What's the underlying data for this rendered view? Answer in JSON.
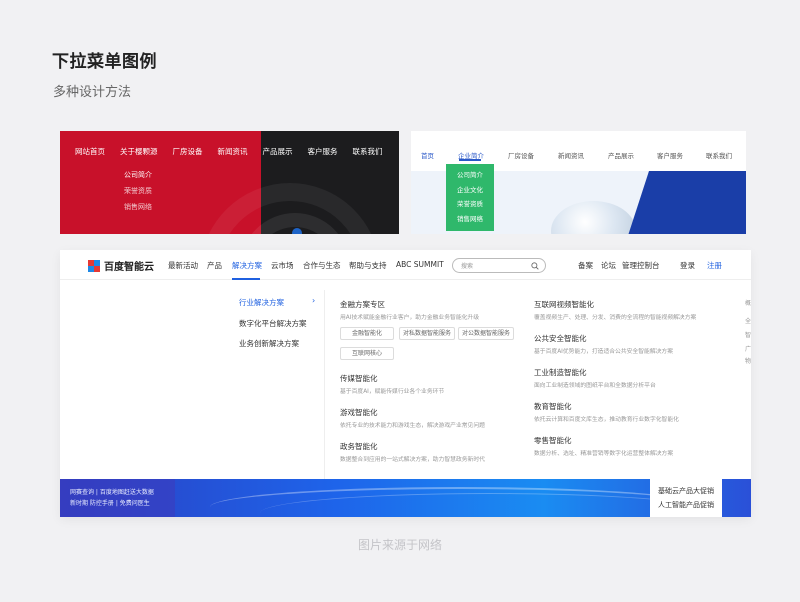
{
  "header": {
    "title": "下拉菜单图例",
    "subtitle": "多种设计方法"
  },
  "footer": {
    "note": "图片来源于网络"
  },
  "example_red": {
    "nav": [
      "网站首页",
      "关于樱颗源",
      "厂房设备",
      "新闻资讯",
      "产品展示",
      "客户服务",
      "联系我们"
    ],
    "dropdown": [
      "公司简介",
      "荣誉资质",
      "销售网络"
    ],
    "colors": {
      "primary": "#c8112a",
      "dark": "#1c1c1e"
    }
  },
  "example_green": {
    "nav": [
      "首页",
      "企业简介",
      "厂房设备",
      "新闻资讯",
      "产品展示",
      "客户服务",
      "联系我们"
    ],
    "dropdown": [
      "公司简介",
      "企业文化",
      "荣誉资质",
      "销售网络"
    ],
    "colors": {
      "dropdown_bg": "#2fb86b",
      "accent": "#2a58c8"
    }
  },
  "example_baidu": {
    "logo_text": "百度智能云",
    "nav": [
      "最新活动",
      "产品",
      "解决方案",
      "云市场",
      "合作与生态",
      "帮助与支持",
      "ABC SUMMIT"
    ],
    "search_placeholder": "搜索",
    "right_links": [
      "备案",
      "论坛",
      "管理控制台",
      "登录",
      "注册"
    ],
    "categories": [
      "行业解决方案",
      "数字化平台解决方案",
      "业务创新解决方案"
    ],
    "finance": {
      "title": "金融方案专区",
      "desc": "用AI技术赋能金融行业客户，助力金融业务智能化升级",
      "tags": [
        "金融智能化",
        "对私数据智能服务",
        "对公数据智能服务",
        "互联网核心"
      ]
    },
    "col1": [
      {
        "title": "传媒智能化",
        "desc": "基于百度AI，赋能传媒行业各个业务环节"
      },
      {
        "title": "游戏智能化",
        "desc": "依托专业的技术能力和游戏生态，解决游戏产业常见问题"
      },
      {
        "title": "政务智能化",
        "desc": "数据整合到应用的一站式解决方案，助力智慧政务新时代"
      }
    ],
    "col2": [
      {
        "title": "互联网视频智能化",
        "desc": "覆盖视频生产、处理、分发、消费的全流程的智能视频解决方案"
      },
      {
        "title": "公共安全智能化",
        "desc": "基于百度AI优势能力，打造适合公共安全智能解决方案"
      },
      {
        "title": "工业制造智能化",
        "desc": "面向工业制造领域的图纸平台和全数据分析平台"
      },
      {
        "title": "教育智能化",
        "desc": "依托云计算和百度文库生态，推动教育行业数字化智能化"
      },
      {
        "title": "零售智能化",
        "desc": "数据分析、选址、精准营销等数字化运营整体解决方案"
      }
    ],
    "far_right": [
      "概",
      "全",
      "智",
      "广",
      "物"
    ],
    "banner": {
      "promo": [
        "网赛查询 | 百度地图赶送大数据",
        "新时期 防控手册 | 免费问医生"
      ],
      "right_links": [
        "基础云产品大促销",
        "人工智能产品促销"
      ]
    },
    "colors": {
      "accent": "#1f60e0"
    }
  }
}
